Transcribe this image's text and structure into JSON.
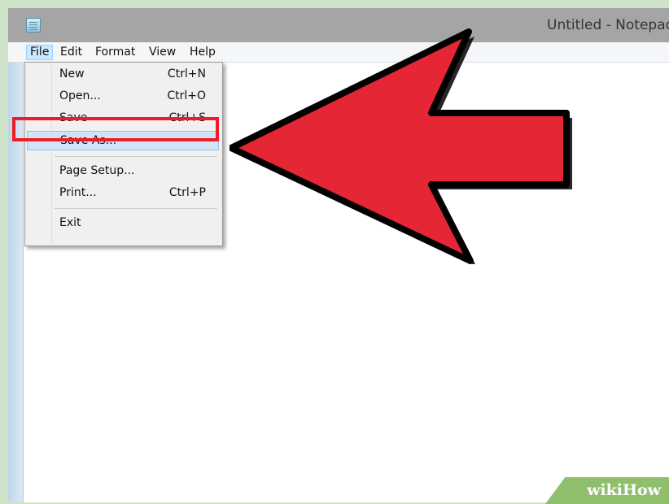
{
  "window": {
    "title": "Untitled - Notepad",
    "icon": "notepad-icon"
  },
  "menubar": {
    "items": [
      "File",
      "Edit",
      "Format",
      "View",
      "Help"
    ],
    "active_item": "File"
  },
  "file_menu": {
    "items": [
      {
        "label": "New",
        "shortcut": "Ctrl+N"
      },
      {
        "label": "Open...",
        "shortcut": "Ctrl+O"
      },
      {
        "label": "Save",
        "shortcut": "Ctrl+S"
      },
      {
        "label": "Save As...",
        "shortcut": ""
      },
      {
        "label": "Page Setup...",
        "shortcut": ""
      },
      {
        "label": "Print...",
        "shortcut": "Ctrl+P"
      },
      {
        "label": "Exit",
        "shortcut": ""
      }
    ],
    "highlighted_item": "Save As..."
  },
  "annotation": {
    "callout_color": "#ee1c25",
    "arrow_color": "#e52634",
    "target": "Save As..."
  },
  "watermark": {
    "text": "wikiHow",
    "color": "#8fbf6d"
  }
}
